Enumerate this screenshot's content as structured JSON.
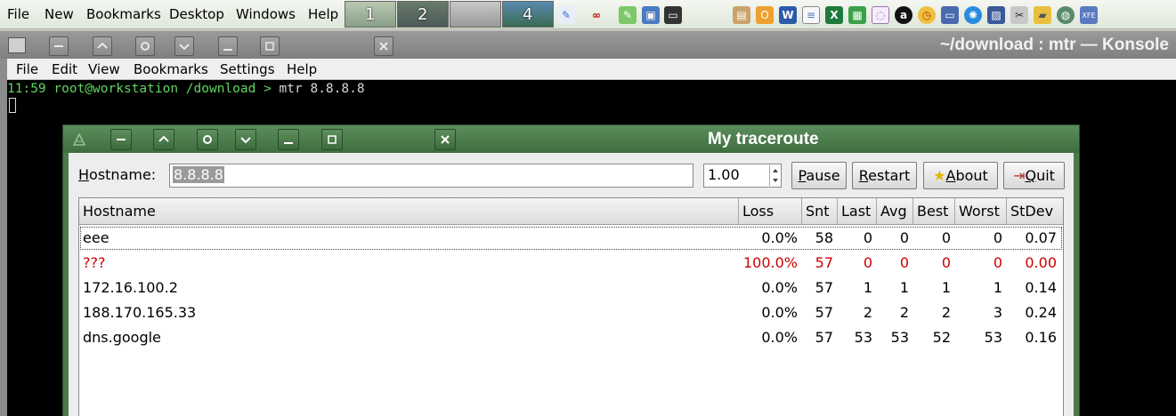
{
  "taskbar": {
    "menus": [
      "File",
      "New",
      "Bookmarks",
      "Desktop",
      "Windows",
      "Help"
    ],
    "desktops": [
      "1",
      "2",
      "3",
      "4"
    ]
  },
  "konsole": {
    "title": "~/download : mtr — Konsole",
    "menus": [
      "File",
      "Edit",
      "View",
      "Bookmarks",
      "Settings",
      "Help"
    ],
    "prompt": "11:59 root@workstation /download > ",
    "command": "mtr 8.8.8.8"
  },
  "traceroute": {
    "title": "My traceroute",
    "hostname_label": "Hostname:",
    "hostname_value": "8.8.8.8",
    "interval_value": "1.00",
    "buttons": {
      "pause": "Pause",
      "restart": "Restart",
      "about": "About",
      "quit": "Quit"
    },
    "columns": [
      "Hostname",
      "Loss",
      "Snt",
      "Last",
      "Avg",
      "Best",
      "Worst",
      "StDev"
    ],
    "rows": [
      {
        "host": "eee",
        "loss": "0.0%",
        "snt": "58",
        "last": "0",
        "avg": "0",
        "best": "0",
        "worst": "0",
        "stdev": "0.07",
        "status": "ok"
      },
      {
        "host": "???",
        "loss": "100.0%",
        "snt": "57",
        "last": "0",
        "avg": "0",
        "best": "0",
        "worst": "0",
        "stdev": "0.00",
        "status": "lost"
      },
      {
        "host": "172.16.100.2",
        "loss": "0.0%",
        "snt": "57",
        "last": "1",
        "avg": "1",
        "best": "1",
        "worst": "1",
        "stdev": "0.14",
        "status": "ok"
      },
      {
        "host": "188.170.165.33",
        "loss": "0.0%",
        "snt": "57",
        "last": "2",
        "avg": "2",
        "best": "2",
        "worst": "3",
        "stdev": "0.24",
        "status": "ok"
      },
      {
        "host": "dns.google",
        "loss": "0.0%",
        "snt": "57",
        "last": "53",
        "avg": "53",
        "best": "52",
        "worst": "53",
        "stdev": "0.16",
        "status": "ok"
      }
    ]
  },
  "colors": {
    "lost_row": "#cc0000",
    "terminal_prompt": "#5fd75f",
    "trace_titlebar": "#4c7a4c"
  }
}
